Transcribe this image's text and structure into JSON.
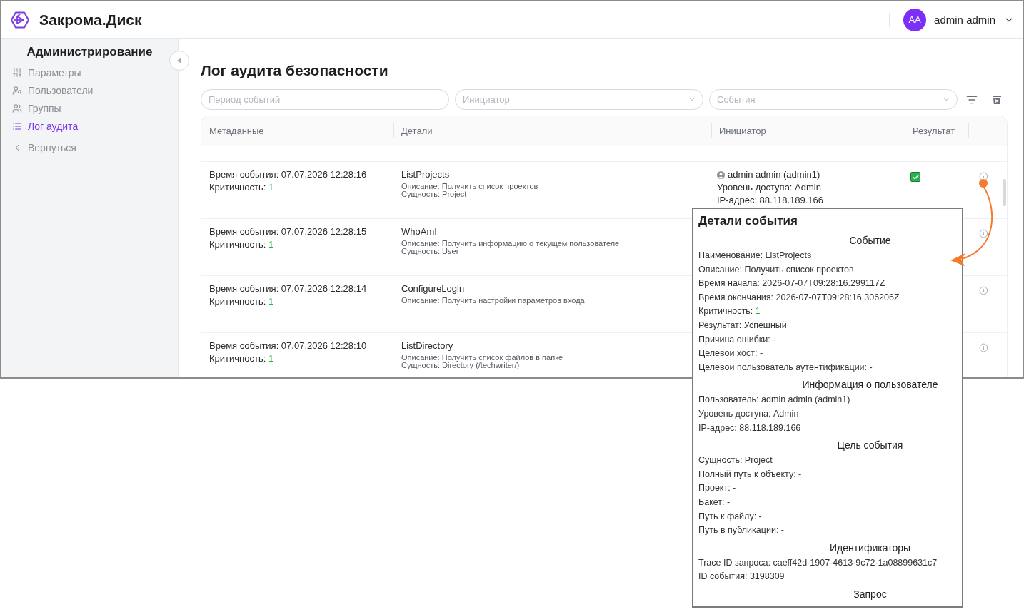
{
  "header": {
    "brand": "Закрома.Диск",
    "user": {
      "initials": "AA",
      "name": "admin admin"
    }
  },
  "sidebar": {
    "title": "Администрирование",
    "items": [
      {
        "label": "Параметры",
        "selected": false
      },
      {
        "label": "Пользователи",
        "selected": false
      },
      {
        "label": "Группы",
        "selected": false
      },
      {
        "label": "Лог аудита",
        "selected": true
      }
    ],
    "back_link": {
      "label": "Вернуться"
    }
  },
  "page": {
    "title": "Лог аудита безопасности"
  },
  "filters": [
    {
      "kind": "text",
      "placeholder": "Период событий"
    },
    {
      "kind": "select",
      "placeholder": "Инициатор"
    },
    {
      "kind": "select",
      "placeholder": "События"
    }
  ],
  "table": {
    "columns": [
      "Метаданные",
      "Детали",
      "Инициатор",
      "Результат"
    ],
    "rows": [
      {
        "time": "Время события: 07.07.2026 12:28:16",
        "criticality": {
          "label": "Критичность:",
          "value": "1"
        },
        "name": "ListProjects",
        "lines": [
          "Описание: Получить список проектов",
          "Сущность: Project"
        ],
        "initiator": {
          "user": "admin admin (admin1)",
          "level": "Уровень доступа: Admin",
          "ip": "IP-адрес: 88.118.189.166"
        },
        "result": {
          "checked": true
        }
      },
      {
        "time": "Время события: 07.07.2026 12:28:15",
        "criticality": {
          "label": "Критичность:",
          "value": "1"
        },
        "name": "WhoAmI",
        "lines": [
          "Описание: Получить информацию о текущем пользователе",
          "Сущность: User"
        ]
      },
      {
        "time": "Время события: 07.07.2026 12:28:14",
        "criticality": {
          "label": "Критичность:",
          "value": "1"
        },
        "name": "ConfigureLogin",
        "lines": [
          "Описание: Получить настройки параметров входа"
        ]
      },
      {
        "time": "Время события: 07.07.2026 12:28:10",
        "criticality": {
          "label": "Критичность:",
          "value": "1"
        },
        "name": "ListDirectory",
        "lines": [
          "Описание: Получить список файлов в папке",
          "Сущность: Directory (/techwriter/)"
        ]
      }
    ]
  },
  "event_details": {
    "title": "Детали события",
    "sections": [
      {
        "heading": "Событие",
        "lines": [
          {
            "kind": "plain",
            "text": "Наименование: ListProjects"
          },
          {
            "kind": "plain",
            "text": "Описание: Получить список проектов"
          },
          {
            "kind": "plain",
            "text": "Время начала: 2026-07-07T09:28:16.299117Z"
          },
          {
            "kind": "plain",
            "text": "Время окончания: 2026-07-07T09:28:16.306206Z"
          },
          {
            "kind": "severity",
            "label": "Критичность:",
            "value": "1"
          },
          {
            "kind": "plain",
            "text": "Результат: Успешный"
          },
          {
            "kind": "plain",
            "text": "Причина ошибки: -"
          },
          {
            "kind": "plain",
            "text": "Целевой хост: -"
          },
          {
            "kind": "plain",
            "text": "Целевой пользователь аутентификации: -"
          }
        ]
      },
      {
        "heading": "Информация о пользователе",
        "lines": [
          {
            "kind": "plain",
            "text": "Пользователь: admin admin (admin1)"
          },
          {
            "kind": "plain",
            "text": "Уровень доступа: Admin"
          },
          {
            "kind": "plain",
            "text": "IP-адрес: 88.118.189.166"
          }
        ]
      },
      {
        "heading": "Цель события",
        "lines": [
          {
            "kind": "plain",
            "text": "Сущность: Project"
          },
          {
            "kind": "plain",
            "text": "Полный путь к объекту: -"
          },
          {
            "kind": "plain",
            "text": "Проект: -"
          },
          {
            "kind": "plain",
            "text": "Бакет: -"
          },
          {
            "kind": "plain",
            "text": "Путь к файлу: -"
          },
          {
            "kind": "plain",
            "text": "Путь в публикации: -"
          }
        ]
      },
      {
        "heading": "Идентификаторы",
        "lines": [
          {
            "kind": "plain",
            "text": "Trace ID запроса: caeff42d-1907-4613-9c72-1a08899631c7"
          },
          {
            "kind": "plain",
            "text": "ID события: 3198309"
          }
        ]
      },
      {
        "heading": "Запрос"
      }
    ]
  }
}
